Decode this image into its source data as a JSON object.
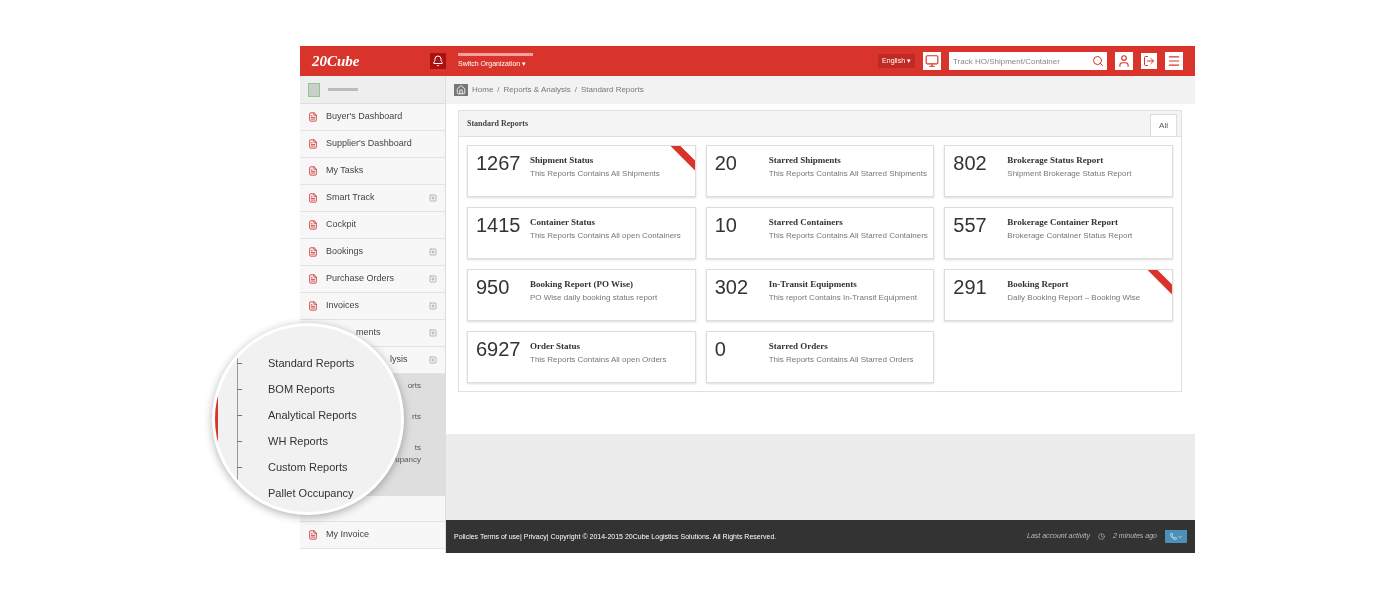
{
  "header": {
    "logo": "20Cube",
    "switch_org": "Switch Organization ▾",
    "language": "English ▾",
    "search": {
      "placeholder": "Track HO/Shipment/Container"
    }
  },
  "breadcrumb": {
    "separator": "/",
    "items": [
      "Home",
      "Reports & Analysis",
      "Standard Reports"
    ]
  },
  "sidebar": {
    "items": [
      {
        "label": "Buyer's Dashboard",
        "expandable": false
      },
      {
        "label": "Supplier's Dashboard",
        "expandable": false
      },
      {
        "label": "My Tasks",
        "expandable": false
      },
      {
        "label": "Smart Track",
        "expandable": true
      },
      {
        "label": "Cockpit",
        "expandable": false
      },
      {
        "label": "Bookings",
        "expandable": true
      },
      {
        "label": "Purchase Orders",
        "expandable": true
      },
      {
        "label": "Invoices",
        "expandable": true
      },
      {
        "label": "ments",
        "expandable": true,
        "kind": "partial"
      },
      {
        "label": "lysis",
        "expandable": true,
        "kind": "partial"
      }
    ],
    "submenu": [
      "orts",
      "rts",
      "ts",
      "upancy"
    ],
    "after_items": [
      {
        "label": "My Invoice",
        "expandable": false
      }
    ]
  },
  "panel": {
    "title": "Standard Reports",
    "tabs": [
      {
        "label": "All",
        "selected": true
      }
    ],
    "cards": [
      {
        "count": "1267",
        "title": "Shipment Status",
        "description": "This Reports Contains All Shipments",
        "ribbon": true
      },
      {
        "count": "20",
        "title": "Starred Shipments",
        "description": "This Reports Contains All Starred Shipments",
        "ribbon": false
      },
      {
        "count": "802",
        "title": "Brokerage Status Report",
        "description": "Shipment Brokerage Status Report",
        "ribbon": false
      },
      {
        "count": "1415",
        "title": "Container Status",
        "description": "This Reports Contains All open Containers",
        "ribbon": false
      },
      {
        "count": "10",
        "title": "Starred Containers",
        "description": "This Reports Contains All Starred Containers",
        "ribbon": false
      },
      {
        "count": "557",
        "title": "Brokerage Container Report",
        "description": "Brokerage Container Status Report",
        "ribbon": false
      },
      {
        "count": "950",
        "title": "Booking Report (PO Wise)",
        "description": "PO Wise daily booking status report",
        "ribbon": false
      },
      {
        "count": "302",
        "title": "In-Transit Equipments",
        "description": "This report Contains In-Transit Equipment",
        "ribbon": false
      },
      {
        "count": "291",
        "title": "Booking Report",
        "description": "Daily Booking Report – Booking Wise",
        "ribbon": true
      },
      {
        "count": "6927",
        "title": "Order Status",
        "description": "This Reports Contains All open Orders",
        "ribbon": false
      },
      {
        "count": "0",
        "title": "Starred Orders",
        "description": "This Reports Contains All Starred Orders",
        "ribbon": false
      }
    ]
  },
  "footer": {
    "text": "Policies Terms of use| Privacy| Copyright © 2014-2015 20Cube Logistics Solutions. All Rights Reserved.",
    "activity_label": "Last account activity",
    "activity_time": "2 minutes ago"
  },
  "magnifier": {
    "items": [
      "Standard Reports",
      "BOM Reports",
      "Analytical Reports",
      "WH Reports",
      "Custom Reports",
      "Pallet Occupancy"
    ]
  }
}
